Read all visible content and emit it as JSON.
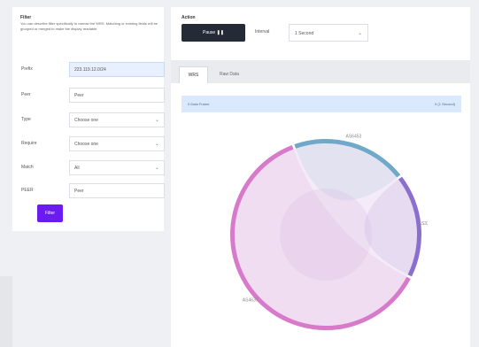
{
  "filter": {
    "title": "Filter",
    "description": "You can describe filter specifically to narrow the WRS. Matching or existing fields will be grouped or merged to make the display readable.",
    "button_label": "Filter",
    "fields": [
      {
        "label": "Prefix",
        "value": "223.119.12.0/24",
        "kind": "text",
        "focused": true
      },
      {
        "label": "Peer",
        "value": "Peer",
        "kind": "text"
      },
      {
        "label": "Type",
        "value": "Choose one",
        "kind": "select"
      },
      {
        "label": "Require",
        "value": "Choose one",
        "kind": "select"
      },
      {
        "label": "Match",
        "value": "All",
        "kind": "select"
      },
      {
        "label": "PEER",
        "value": "Peer",
        "kind": "text"
      }
    ]
  },
  "action": {
    "label": "Action",
    "pause_label": "Pause ❚❚",
    "interval_label": "Interval",
    "interval_value": "1 Second"
  },
  "tabs": [
    {
      "label": "WRS",
      "active": true
    },
    {
      "label": "Raw Data",
      "active": false
    }
  ],
  "info": {
    "left": "0 Data Frame",
    "right": "0 (1 Second)"
  },
  "chord": {
    "groups": [
      {
        "label": "AS6453",
        "value": 20,
        "color": "#6fa8c9"
      },
      {
        "label": "AS3356",
        "value": 18,
        "color": "#8b6fcf"
      },
      {
        "label": "AS4637",
        "value": 62,
        "color": "#d77ac9"
      }
    ]
  }
}
